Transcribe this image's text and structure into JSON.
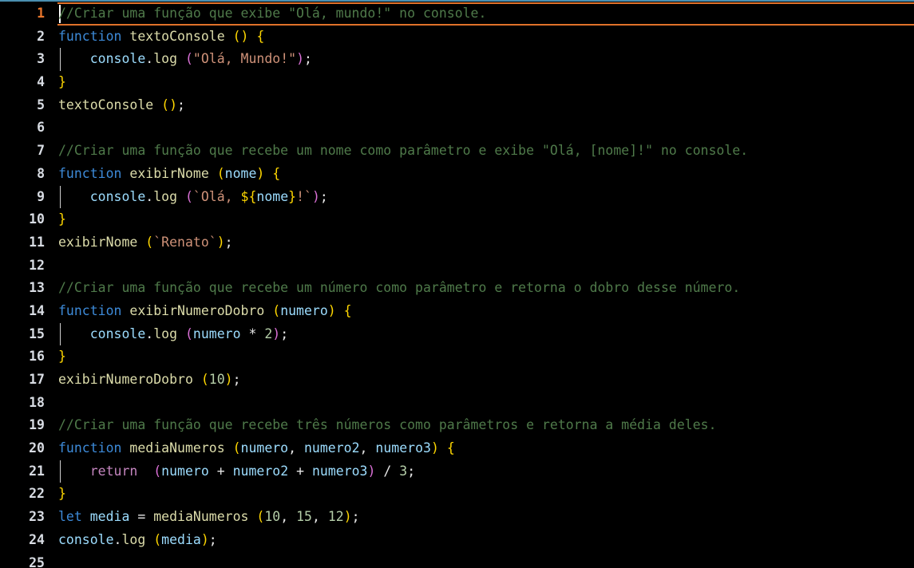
{
  "editor": {
    "language": "javascript",
    "theme": "Dark+ (black background)",
    "background_color": "#000000",
    "active_line": 1,
    "cursor_line": 1,
    "cursor_column": 1,
    "total_lines_visible": 25,
    "line_number_color": "#d8dce3",
    "active_line_number_color": "#e8762c",
    "active_line_border_color": "#e0712a",
    "top_rule_color": "#4a8fb0",
    "colors": {
      "comment": "#4f7a4a",
      "keyword": "#3d8ad8",
      "control_keyword": "#c586c0",
      "function_name": "#dcdcaa",
      "variable": "#9cdcfe",
      "string": "#ce9178",
      "number": "#b5cea8",
      "bracket_level_1": "#ffd700",
      "bracket_level_2": "#da70d6",
      "bracket_level_3": "#179fff",
      "plain_text": "#e6e6e6",
      "indent_guide": "#cfcfcf",
      "cursor": "#ffffff"
    }
  },
  "lines": [
    {
      "n": "1",
      "text": "//Criar uma função que exibe \"Olá, mundo!\" no console."
    },
    {
      "n": "2",
      "text": "function textoConsole () {"
    },
    {
      "n": "3",
      "text": "    console.log (\"Olá, Mundo!\");"
    },
    {
      "n": "4",
      "text": "}"
    },
    {
      "n": "5",
      "text": "textoConsole ();"
    },
    {
      "n": "6",
      "text": ""
    },
    {
      "n": "7",
      "text": "//Criar uma função que recebe um nome como parâmetro e exibe \"Olá, [nome]!\" no console."
    },
    {
      "n": "8",
      "text": "function exibirNome (nome) {"
    },
    {
      "n": "9",
      "text": "    console.log (`Olá, ${nome}!`);"
    },
    {
      "n": "10",
      "text": "}"
    },
    {
      "n": "11",
      "text": "exibirNome (`Renato`);"
    },
    {
      "n": "12",
      "text": ""
    },
    {
      "n": "13",
      "text": "//Criar uma função que recebe um número como parâmetro e retorna o dobro desse número."
    },
    {
      "n": "14",
      "text": "function exibirNumeroDobro (numero) {"
    },
    {
      "n": "15",
      "text": "    console.log (numero * 2);"
    },
    {
      "n": "16",
      "text": "}"
    },
    {
      "n": "17",
      "text": "exibirNumeroDobro (10);"
    },
    {
      "n": "18",
      "text": ""
    },
    {
      "n": "19",
      "text": "//Criar uma função que recebe três números como parâmetros e retorna a média deles."
    },
    {
      "n": "20",
      "text": "function mediaNumeros (numero, numero2, numero3) {"
    },
    {
      "n": "21",
      "text": "    return  (numero + numero2 + numero3) / 3;"
    },
    {
      "n": "22",
      "text": "}"
    },
    {
      "n": "23",
      "text": "let media = mediaNumeros (10, 15, 12);"
    },
    {
      "n": "24",
      "text": "console.log (media);"
    },
    {
      "n": "25",
      "text": ""
    }
  ]
}
